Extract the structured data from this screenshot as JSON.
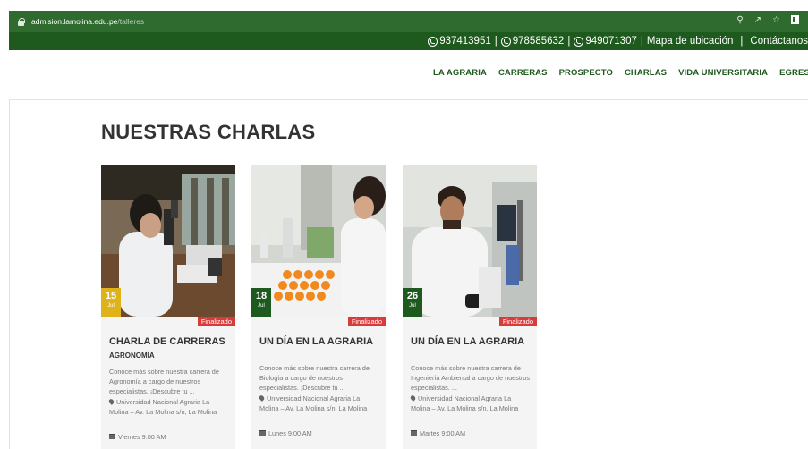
{
  "browser": {
    "url_host": "admision.lamolina.edu.pe",
    "url_path": "/talleres"
  },
  "contact": {
    "phones": [
      "937413951",
      "978585632",
      "949071307"
    ],
    "map_link": "Mapa de ubicación",
    "contact_link": "Contáctanos"
  },
  "nav": {
    "items": [
      "LA AGRARIA",
      "CARRERAS",
      "PROSPECTO",
      "CHARLAS",
      "VIDA UNIVERSITARIA",
      "EGRESADOS"
    ]
  },
  "page": {
    "title": "NUESTRAS CHARLAS"
  },
  "cards": [
    {
      "day": "15",
      "month": "Jul",
      "date_color": "#e0b21a",
      "status": "Finalizado",
      "title": "CHARLA DE CARRERAS",
      "subtitle": "AGRONOMÍA",
      "description": "Conoce más sobre nuestra carrera de Agronomía a cargo de nuestros especialistas. ¡Descubre tu ...",
      "location": "Universidad Nacional Agraria La Molina – Av. La Molina s/n, La Molina",
      "time": "Viernes 9:00 AM"
    },
    {
      "day": "18",
      "month": "Jul",
      "date_color": "#1e5a1e",
      "status": "Finalizado",
      "title": "UN DÍA EN LA AGRARIA",
      "subtitle": "",
      "description": "Conoce más sobre nuestra carrera de Biología a cargo de nuestros especialistas. ¡Descubre tu ...",
      "location": "Universidad Nacional Agraria La Molina – Av. La Molina s/n, La Molina",
      "time": "Lunes 9:00 AM"
    },
    {
      "day": "26",
      "month": "Jul",
      "date_color": "#1e5a1e",
      "status": "Finalizado",
      "title": "UN DÍA EN LA AGRARIA",
      "subtitle": "",
      "description": "Conoce más sobre nuestra carrera de Ingeniería Ambiental a cargo de nuestros especialistas. ...",
      "location": "Universidad Nacional Agraria La Molina – Av. La Molina s/n, La Molina",
      "time": "Martes 9:00 AM"
    }
  ],
  "colors": {
    "brand_green": "#1e5a1e",
    "badge_red": "#d93b3b"
  }
}
